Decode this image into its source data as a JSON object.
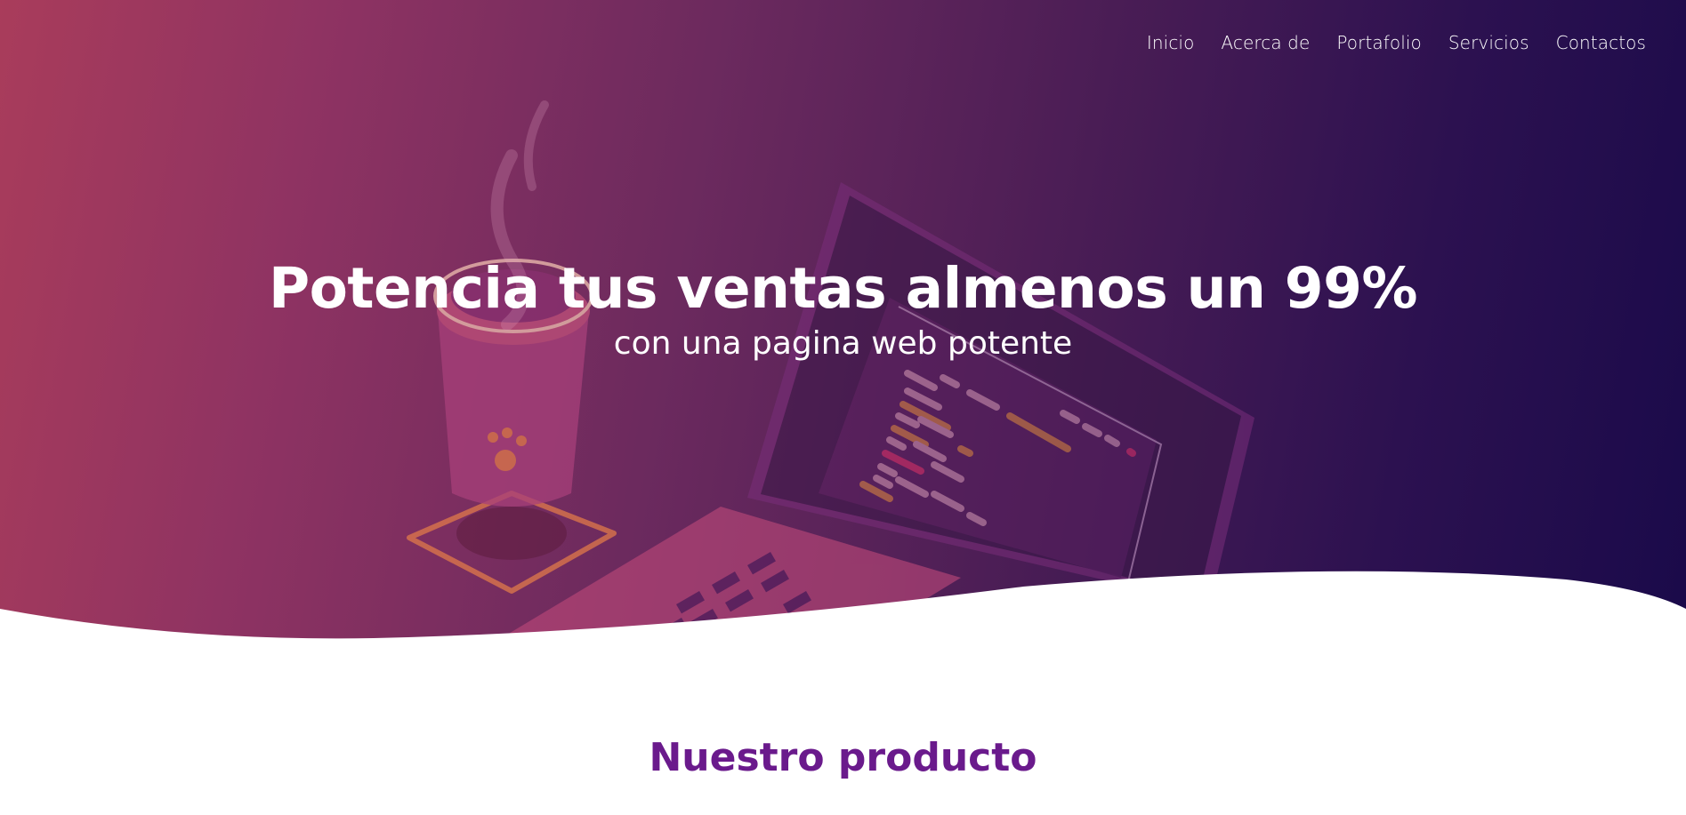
{
  "nav": {
    "items": [
      {
        "label": "Inicio"
      },
      {
        "label": "Acerca de"
      },
      {
        "label": "Portafolio"
      },
      {
        "label": "Servicios"
      },
      {
        "label": "Contactos"
      }
    ]
  },
  "hero": {
    "title": "Potencia tus ventas almenos un 99%",
    "subtitle": "con una pagina web potente"
  },
  "section": {
    "title": "Nuestro producto"
  },
  "colors": {
    "gradient_start": "#a93c5b",
    "gradient_end": "#1a0a4a",
    "section_title": "#6a1a8c"
  }
}
